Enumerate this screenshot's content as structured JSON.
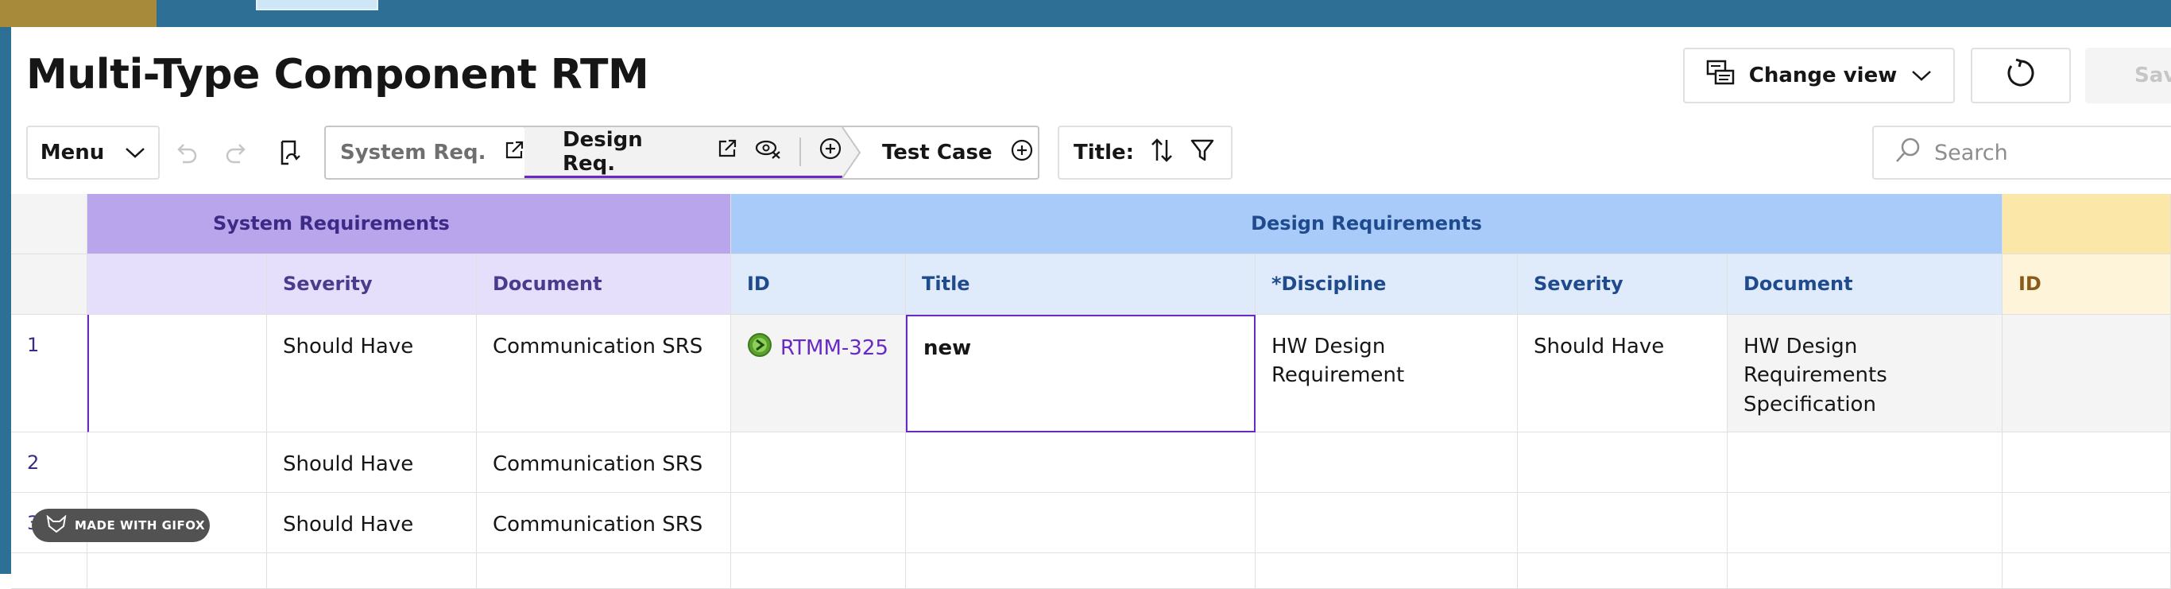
{
  "page": {
    "title": "Multi-Type Component RTM"
  },
  "header_actions": {
    "change_view_label": "Change view",
    "save_label": "Save"
  },
  "toolbar": {
    "menu_label": "Menu",
    "breadcrumb": [
      {
        "label": "System Req."
      },
      {
        "label": "Design Req."
      },
      {
        "label": "Test Case"
      }
    ],
    "title_sort_label": "Title:",
    "search_placeholder": "Search"
  },
  "grid": {
    "groups": [
      {
        "label": "System Requirements"
      },
      {
        "label": "Design Requirements"
      },
      {
        "label": ""
      }
    ],
    "columns": {
      "system": [
        "",
        "Severity",
        "Document"
      ],
      "design": [
        "ID",
        "Title",
        "*Discipline",
        "Severity",
        "Document"
      ],
      "test_case": [
        "ID"
      ]
    },
    "rows": [
      {
        "num": "1",
        "sys_severity": "Should Have",
        "sys_document": "Communication SRS",
        "des_id": "RTMM-325",
        "des_title": "new",
        "des_discipline": "HW Design Requirement",
        "des_severity": "Should Have",
        "des_document": "HW Design Requirements Specification"
      },
      {
        "num": "2",
        "sys_severity": "Should Have",
        "sys_document": "Communication SRS",
        "des_id": "",
        "des_title": "",
        "des_discipline": "",
        "des_severity": "",
        "des_document": ""
      },
      {
        "num": "3",
        "sys_severity": "Should Have",
        "sys_document": "Communication SRS",
        "des_id": "",
        "des_title": "",
        "des_discipline": "",
        "des_severity": "",
        "des_document": ""
      }
    ]
  },
  "watermark": "MADE WITH GIFOX",
  "colors": {
    "accent": "#6929c4",
    "system_group": "#b8a5ec",
    "design_group": "#a9cbfa",
    "test_group": "#fbe7a7",
    "topbar": "#2e6f96"
  }
}
